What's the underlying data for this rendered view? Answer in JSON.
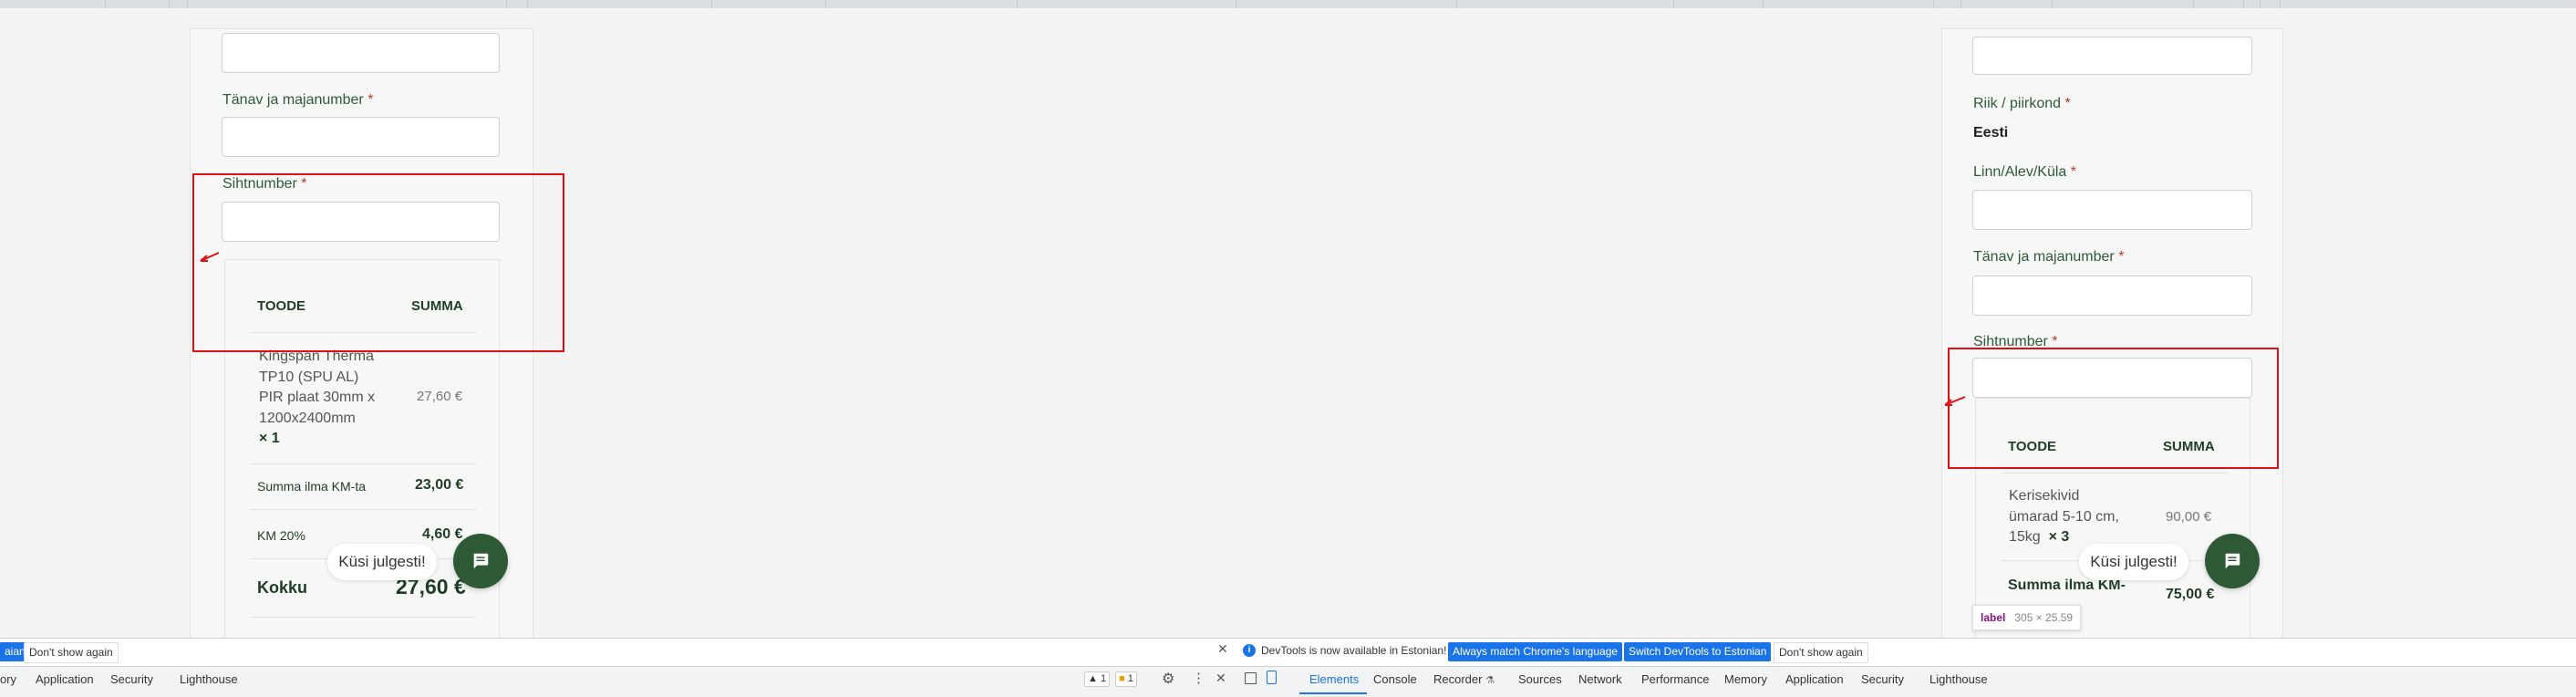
{
  "left": {
    "street_label": "Tänav ja majanumber",
    "zip_label": "Sihtnumber",
    "required_mark": "*",
    "table_header_product": "TOODE",
    "table_header_sum": "SUMMA",
    "product_name_lines": [
      "Kingspan Therma",
      "TP10 (SPU AL)",
      "PIR plaat 30mm x",
      "1200x2400mm"
    ],
    "product_qty": "× 1",
    "product_price": "27,60 €",
    "subtotal_label": "Summa ilma KM-ta",
    "subtotal_value": "23,00 €",
    "vat_label": "KM 20%",
    "vat_value": "4,60 €",
    "total_label": "Kokku",
    "total_value": "27,60 €",
    "chat_label": "Küsi julgesti!"
  },
  "right": {
    "country_label": "Riik / piirkond",
    "country_value": "Eesti",
    "city_label": "Linn/Alev/Küla",
    "street_label": "Tänav ja majanumber",
    "zip_label": "Sihtnumber",
    "required_mark": "*",
    "table_header_product": "TOODE",
    "table_header_sum": "SUMMA",
    "product_name_lines": [
      "Kerisekivid",
      "ümarad 5-10 cm,",
      "15kg"
    ],
    "product_qty": "× 3",
    "product_price": "90,00 €",
    "subtotal_label": "Summa ilma KM-",
    "subtotal_value": "75,00 €",
    "chat_label": "Küsi julgesti!",
    "tooltip_tag": "label",
    "tooltip_size": "305 × 25.59"
  },
  "devtools": {
    "left_pane": {
      "lang_button_partial": "aian",
      "dont_show": "Don't show again",
      "tabs": [
        "ory",
        "Application",
        "Security",
        "Lighthouse"
      ]
    },
    "right_pane": {
      "notice": "DevTools is now available in Estonian!",
      "match_button": "Always match Chrome's language",
      "switch_button": "Switch DevTools to Estonian",
      "dont_show": "Don't show again",
      "warn_count": "1",
      "issue_count": "1",
      "tabs": [
        "Elements",
        "Console",
        "Recorder",
        "Sources",
        "Network",
        "Performance",
        "Memory",
        "Application",
        "Security",
        "Lighthouse"
      ],
      "active_tab": "Elements"
    }
  },
  "icons": {
    "chat": "chat-bubble-icon",
    "close": "close-icon",
    "info": "info-icon",
    "gear": "gear-icon",
    "more": "more-vert-icon",
    "inspect": "inspect-icon",
    "device": "device-toggle-icon",
    "cursor_arrow": "cursor-arrow-icon"
  },
  "colors": {
    "brand_green": "#2d5a35",
    "highlight_red": "#e01010",
    "devtools_blue": "#1a73e8"
  }
}
